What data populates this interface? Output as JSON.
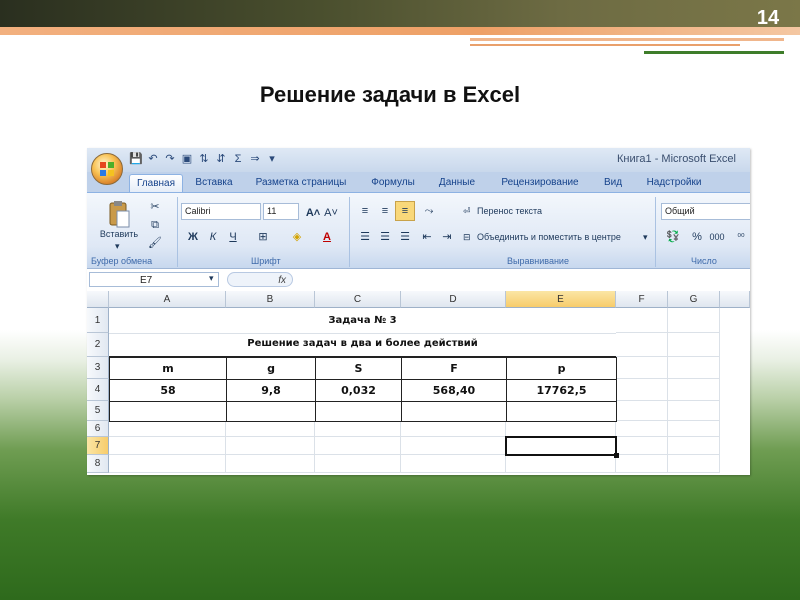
{
  "slide": {
    "number": "14",
    "title": "Решение задачи в Excel"
  },
  "excel": {
    "window_title": "Книга1 - Microsoft Excel",
    "tabs": [
      "Главная",
      "Вставка",
      "Разметка страницы",
      "Формулы",
      "Данные",
      "Рецензирование",
      "Вид",
      "Надстройки"
    ],
    "active_tab": "Главная",
    "ribbon": {
      "clipboard": {
        "paste_label": "Вставить",
        "group_label": "Буфер обмена"
      },
      "font": {
        "font_name": "Calibri",
        "font_size": "11",
        "group_label": "Шрифт",
        "bold": "Ж",
        "italic": "К",
        "underline": "Ч"
      },
      "alignment": {
        "wrap_text": "Перенос текста",
        "merge_center": "Объединить и поместить в центре",
        "group_label": "Выравнивание"
      },
      "number": {
        "format": "Общий",
        "group_label": "Число",
        "percent": "%",
        "thousands": "000"
      }
    },
    "formula_bar": {
      "name_box": "E7",
      "fx": "fx"
    },
    "columns": [
      "A",
      "B",
      "C",
      "D",
      "E",
      "F",
      "G"
    ],
    "rows": [
      "1",
      "2",
      "3",
      "4",
      "5",
      "6",
      "7",
      "8"
    ],
    "title_row1": "Задача № 3",
    "title_row2": "Решение задач в два и более действий",
    "headers": [
      "m",
      "g",
      "S",
      "F",
      "p"
    ],
    "values": [
      "58",
      "9,8",
      "0,032",
      "568,40",
      "17762,5"
    ],
    "selected_cell": "E7"
  }
}
